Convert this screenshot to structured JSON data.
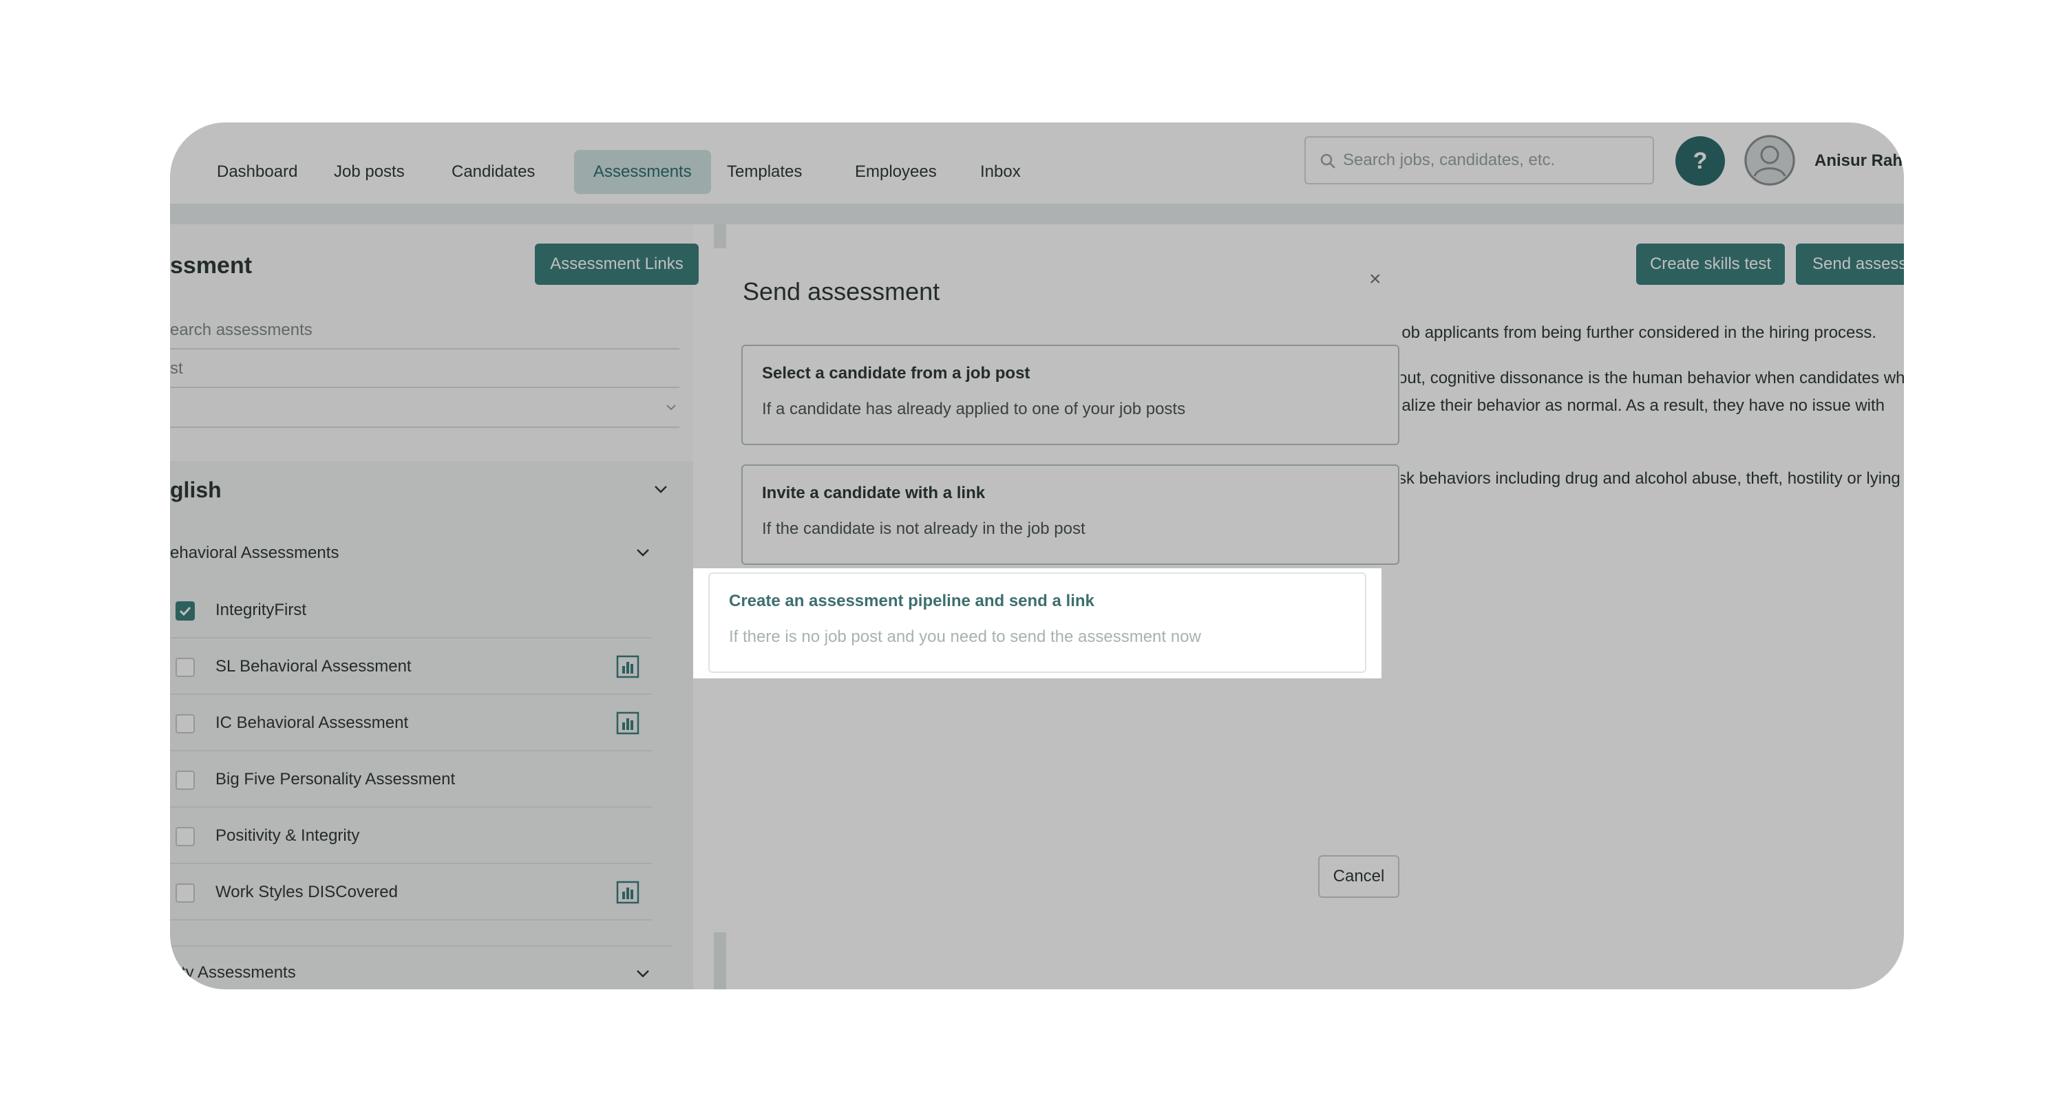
{
  "nav": {
    "items": [
      {
        "label": "Dashboard"
      },
      {
        "label": "Job posts"
      },
      {
        "label": "Candidates"
      },
      {
        "label": "Assessments",
        "active": true
      },
      {
        "label": "Templates"
      },
      {
        "label": "Employees"
      },
      {
        "label": "Inbox"
      }
    ],
    "search_placeholder": "Search jobs, candidates, etc.",
    "help_label": "?",
    "user_name": "Anisur Rahr"
  },
  "left": {
    "title": "ssment",
    "assessment_links_button": "Assessment Links",
    "search_placeholder": "earch assessments",
    "filter_value": "st",
    "language": "glish",
    "behavioral_section": "ehavioral Assessments",
    "items": [
      {
        "label": "IntegrityFirst",
        "checked": true,
        "report_icon": false
      },
      {
        "label": "SL Behavioral Assessment",
        "checked": false,
        "report_icon": true
      },
      {
        "label": "IC Behavioral Assessment",
        "checked": false,
        "report_icon": true
      },
      {
        "label": "Big Five Personality Assessment",
        "checked": false,
        "report_icon": false
      },
      {
        "label": "Positivity & Integrity",
        "checked": false,
        "report_icon": false
      },
      {
        "label": "Work Styles DISCovered",
        "checked": false,
        "report_icon": true
      }
    ],
    "ability_section": "ility Assessments"
  },
  "right": {
    "create_skills_test_button": "Create skills test",
    "send_assessment_button": "Send assessi",
    "paragraphs": [
      "job applicants from being further considered in the hiring process.",
      "out, cognitive dissonance is the human behavior when candidates wh",
      "ialize their behavior as normal. As a result, they have no issue with",
      "sk behaviors including drug and alcohol abuse, theft, hostility or lying"
    ]
  },
  "modal": {
    "title": "Send assessment",
    "close_label": "×",
    "options": [
      {
        "title": "Select a candidate from a job post",
        "desc": "If a candidate has already applied to one of your job posts"
      },
      {
        "title": "Invite a candidate with a link",
        "desc": "If the candidate is not already in the job post"
      },
      {
        "title": "Create an assessment pipeline and send a link",
        "desc": "If there is no job post and you need to send the assessment now"
      }
    ],
    "cancel_label": "Cancel"
  },
  "colors": {
    "brand": "#3d7f7d",
    "nav_active_bg": "#cfe2e2",
    "overlay": "rgba(0,0,0,0.25)"
  }
}
